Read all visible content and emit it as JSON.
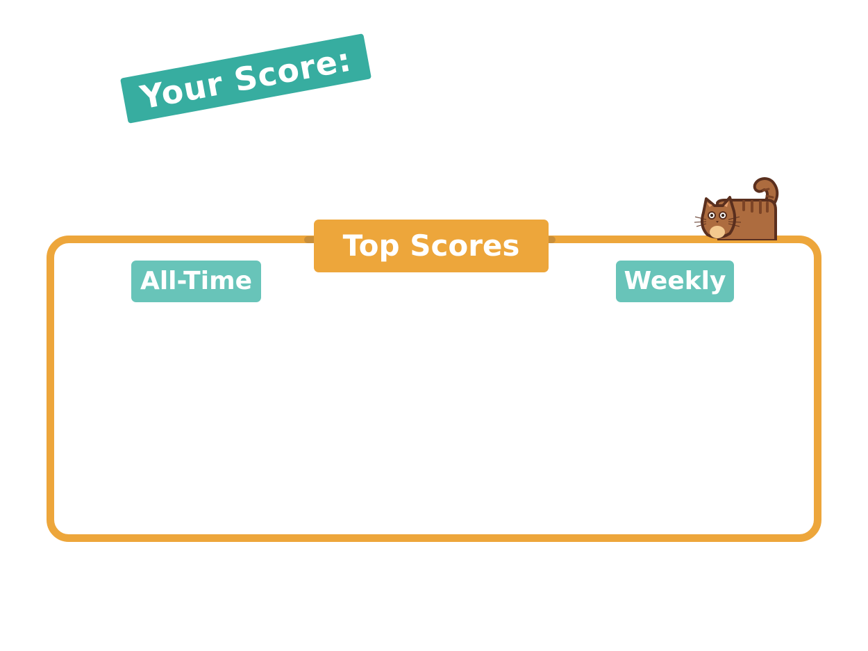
{
  "your_score": {
    "label": "Your Score:",
    "value": ""
  },
  "leaderboard": {
    "title": "Top Scores",
    "tabs": {
      "all_time": "All-Time",
      "weekly": "Weekly"
    },
    "all_time_entries": [],
    "weekly_entries": []
  },
  "mascot": {
    "icon": "cat-icon"
  },
  "colors": {
    "teal_banner": "#37ada0",
    "teal_tab": "#68c4b9",
    "orange": "#eda63b",
    "cat_body": "#ad6c3f",
    "cat_outline": "#5a2f1e"
  }
}
